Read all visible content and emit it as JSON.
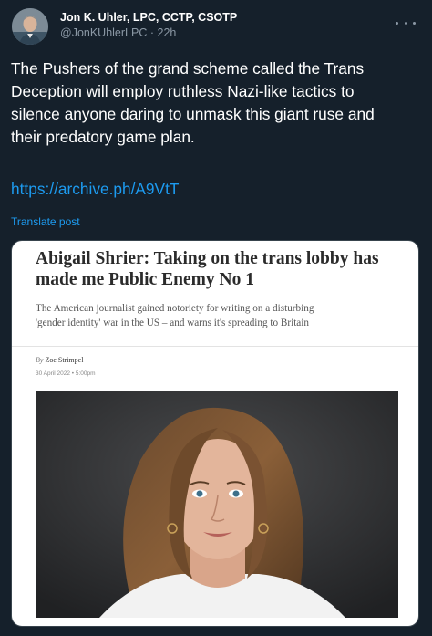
{
  "tweet": {
    "author_name": "Jon K. Uhler, LPC, CCTP, CSOTP",
    "handle": "@JonKUhlerLPC",
    "time": "22h",
    "text_lines": [
      "The Pushers of the grand scheme called the Trans",
      "Deception will employ ruthless Nazi-like tactics to",
      "silence anyone daring to unmask this giant ruse and",
      "their predatory game plan."
    ],
    "link": "https://archive.ph/A9VtT",
    "translate_label": "Translate post"
  },
  "card": {
    "headline_lines": [
      "Abigail Shrier: Taking on the trans lobby has",
      "made me Public Enemy No 1"
    ],
    "standfirst_lines": [
      "The American journalist gained notoriety for writing on a disturbing",
      "'gender identity' war in the US – and warns it's spreading to Britain"
    ],
    "byline_prefix": "By",
    "author": "Zoe Strimpel",
    "date": "30 April 2022 • 5:00pm"
  },
  "icons": {
    "more": "more-horizontal-icon",
    "avatar": "avatar-photo"
  },
  "colors": {
    "background": "#15202b",
    "link": "#1d9bf0",
    "secondary_text": "#8b98a5"
  }
}
